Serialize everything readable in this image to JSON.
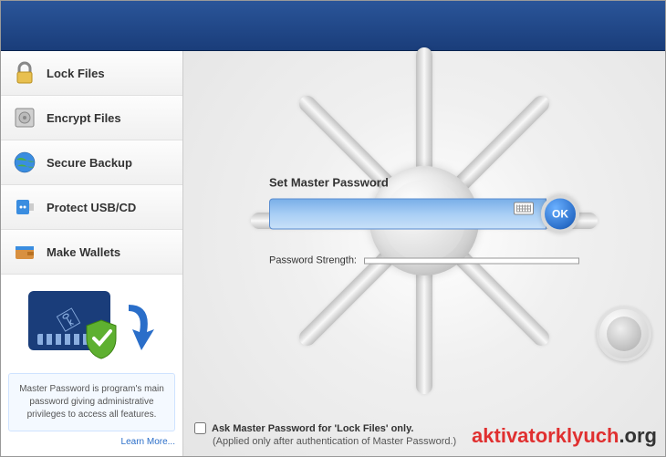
{
  "sidebar": {
    "items": [
      {
        "label": "Lock Files",
        "icon": "lock-icon"
      },
      {
        "label": "Encrypt Files",
        "icon": "safe-icon"
      },
      {
        "label": "Secure Backup",
        "icon": "globe-icon"
      },
      {
        "label": "Protect USB/CD",
        "icon": "usb-icon"
      },
      {
        "label": "Make Wallets",
        "icon": "wallet-icon"
      }
    ]
  },
  "promo": {
    "text": "Master Password is program's main password giving administrative privileges to access all features.",
    "learn_more": "Learn More..."
  },
  "main": {
    "heading": "Set Master Password",
    "ok_label": "OK",
    "strength_label": "Password Strength:",
    "checkbox_label": "Ask Master Password for 'Lock Files' only.",
    "checkbox_sub": "(Applied only after authentication of Master Password.)"
  },
  "watermark": {
    "part1": "aktivatorklyuch",
    "part2": ".org"
  }
}
